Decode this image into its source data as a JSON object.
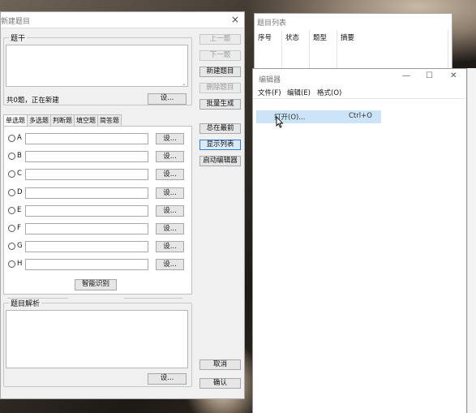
{
  "main_window": {
    "title": "新建题目",
    "close": "×",
    "stem_group_label": "题干",
    "status": "共0题，正在新建",
    "set_button": "设...",
    "nav": {
      "prev": "上一题",
      "next": "下一题",
      "new": "新建题目",
      "delete": "删除题目",
      "batch": "批量生成"
    },
    "tabs": [
      "单选题",
      "多选题",
      "判断题",
      "填空题",
      "简答题"
    ],
    "options": [
      {
        "label": "A",
        "button": "设..."
      },
      {
        "label": "B",
        "button": "设..."
      },
      {
        "label": "C",
        "button": "设..."
      },
      {
        "label": "D",
        "button": "设..."
      },
      {
        "label": "E",
        "button": "设..."
      },
      {
        "label": "F",
        "button": "设..."
      },
      {
        "label": "G",
        "button": "设..."
      },
      {
        "label": "H",
        "button": "设..."
      }
    ],
    "smart_recognize": "智能识别",
    "side": {
      "always_on_top": "总在最前",
      "show_list": "显示列表",
      "start_editor": "启动编辑器"
    },
    "analysis_group_label": "题目解析",
    "analysis_set_button": "设...",
    "cancel": "取消",
    "confirm": "确认"
  },
  "list_window": {
    "title": "题目列表",
    "columns": [
      "序号",
      "状态",
      "题型",
      "摘要"
    ]
  },
  "editor_window": {
    "title": "编辑器",
    "controls": {
      "minimize": "—",
      "maximize": "☐",
      "close": "✕"
    },
    "menu": [
      "文件(F)",
      "编辑(E)",
      "格式(O)"
    ],
    "dropdown_item": {
      "label": "打开(O)...",
      "shortcut": "Ctrl+O"
    }
  }
}
